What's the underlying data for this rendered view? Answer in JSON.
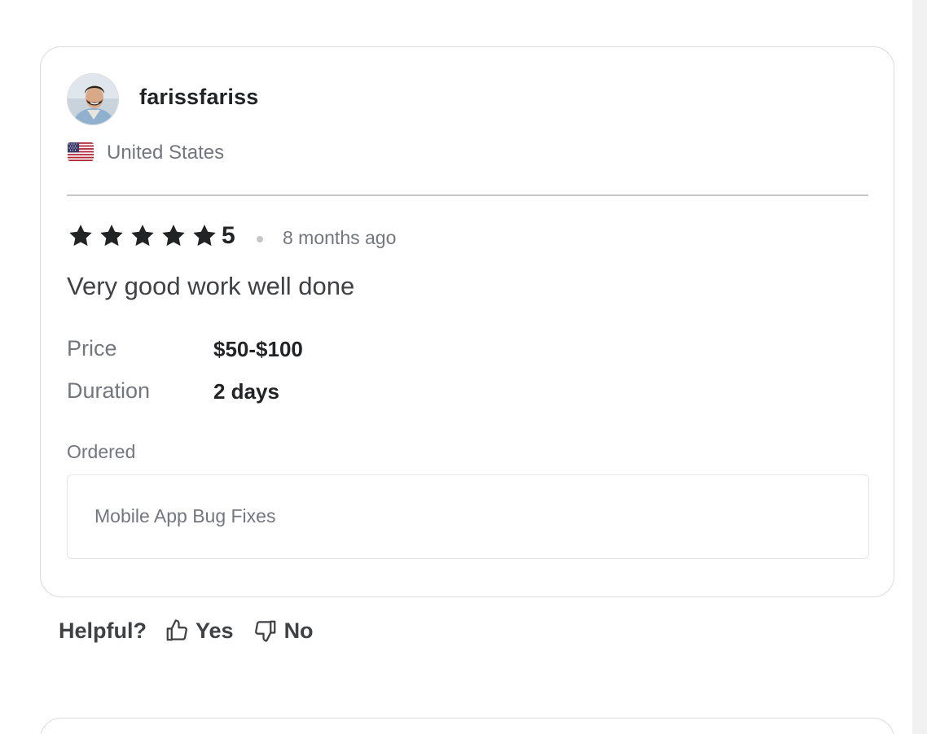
{
  "review": {
    "username": "farissfariss",
    "country": "United States",
    "rating": "5",
    "rating_stars": 5,
    "time_ago": "8 months ago",
    "text": "Very good work well done",
    "price_label": "Price",
    "price_value": "$50-$100",
    "duration_label": "Duration",
    "duration_value": "2 days",
    "ordered_label": "Ordered",
    "ordered_item": "Mobile App Bug Fixes"
  },
  "feedback": {
    "helpful_label": "Helpful?",
    "yes_label": "Yes",
    "no_label": "No"
  },
  "icons": {
    "star": "star-icon",
    "thumbs_up": "thumbs-up-icon",
    "thumbs_down": "thumbs-down-icon",
    "flag": "us-flag-icon"
  },
  "colors": {
    "primary_text": "#222325",
    "secondary_text": "#74767e",
    "border": "#dadbdd"
  }
}
